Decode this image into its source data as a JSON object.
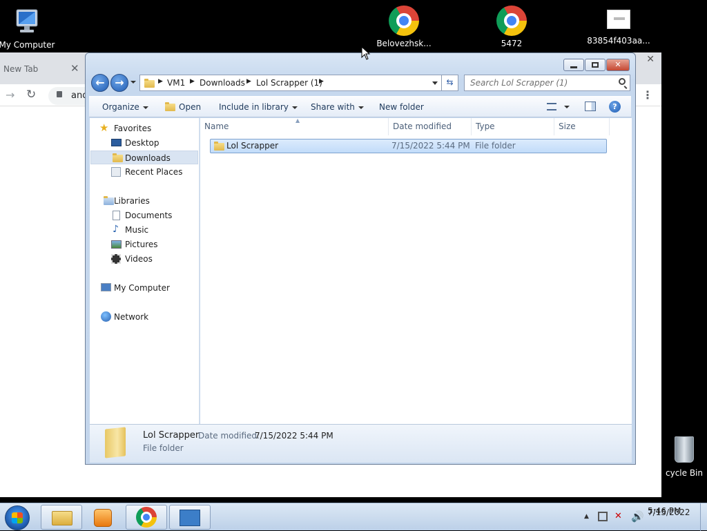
{
  "desktop": {
    "icons": [
      {
        "label": "My Computer",
        "icon": "computer-icon"
      },
      {
        "label": "Belovezhsk...",
        "icon": "chrome-icon"
      },
      {
        "label": "5472",
        "icon": "chrome-icon"
      },
      {
        "label": "83854f403aa...",
        "icon": "image-file-icon"
      }
    ],
    "recycle_bin_label": "cycle Bin"
  },
  "background_browser": {
    "tab_title": "New Tab",
    "omnibox_text": "and"
  },
  "explorer": {
    "breadcrumb": [
      "VM1",
      "Downloads",
      "Lol Scrapper (1)"
    ],
    "search_placeholder": "Search Lol Scrapper (1)",
    "commands": {
      "organize": "Organize",
      "open": "Open",
      "include_in_library": "Include in library",
      "share_with": "Share with",
      "new_folder": "New folder"
    },
    "nav": {
      "favorites": "Favorites",
      "desktop": "Desktop",
      "downloads": "Downloads",
      "recent_places": "Recent Places",
      "libraries": "Libraries",
      "documents": "Documents",
      "music": "Music",
      "pictures": "Pictures",
      "videos": "Videos",
      "my_computer": "My Computer",
      "network": "Network"
    },
    "columns": [
      "Name",
      "Date modified",
      "Type",
      "Size"
    ],
    "files": [
      {
        "name": "Lol Scrapper",
        "date_modified": "7/15/2022 5:44 PM",
        "type": "File folder",
        "size": ""
      }
    ],
    "details": {
      "name": "Lol Scrapper",
      "date_label": "Date modified:",
      "date_value": "7/15/2022 5:44 PM",
      "type": "File folder"
    }
  },
  "taskbar": {
    "time": "5:46 PM",
    "date": "7/15/2022"
  },
  "colors": {
    "desktop_bg": "#000000",
    "selection": "#cce2fb",
    "accent": "#1f5cb3"
  }
}
